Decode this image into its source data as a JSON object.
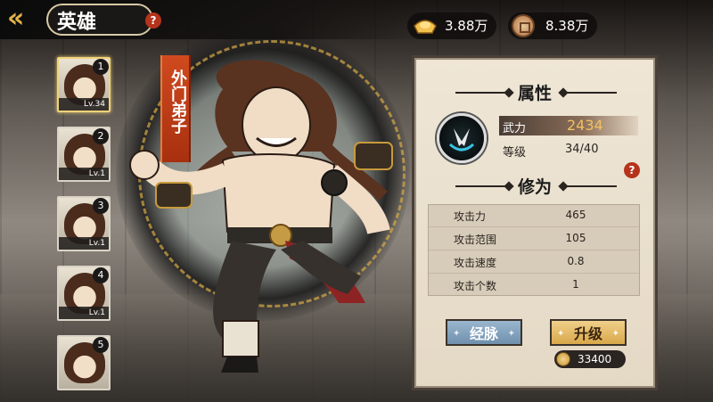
{
  "header": {
    "title": "英雄",
    "help": "?",
    "back_icon": "back-arrow-icon"
  },
  "currency": {
    "gold": {
      "icon": "gold-ingot-icon",
      "value": "3.88万"
    },
    "coin": {
      "icon": "copper-coin-icon",
      "value": "8.38万"
    }
  },
  "hero_list": [
    {
      "num": "1",
      "level": "Lv.34",
      "selected": true
    },
    {
      "num": "2",
      "level": "Lv.1",
      "selected": false
    },
    {
      "num": "3",
      "level": "Lv.1",
      "selected": false
    },
    {
      "num": "4",
      "level": "Lv.1",
      "selected": false
    },
    {
      "num": "5",
      "level": "",
      "selected": false
    }
  ],
  "hero": {
    "name": "外门弟子"
  },
  "panel": {
    "attributes_title": "属性",
    "martial_label": "武力",
    "martial_value": "2434",
    "level_label": "等级",
    "level_value": "34/40",
    "help": "?",
    "cultivation_title": "修为",
    "stats": [
      {
        "name": "攻击力",
        "value": "465"
      },
      {
        "name": "攻击范围",
        "value": "105"
      },
      {
        "name": "攻击速度",
        "value": "0.8"
      },
      {
        "name": "攻击个数",
        "value": "1"
      }
    ],
    "meridian_label": "经脉",
    "upgrade_label": "升级",
    "upgrade_cost": "33400"
  },
  "colors": {
    "accent_gold": "#e3b44c",
    "martial_value": "#f1c160",
    "name_banner": "#c0401a",
    "help_badge": "#b5331c"
  }
}
